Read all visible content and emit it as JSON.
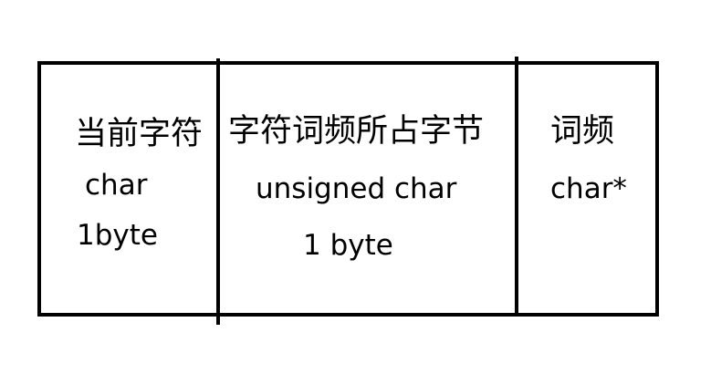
{
  "cells": [
    {
      "title": "当前字符",
      "line1": "char",
      "line2": "1byte"
    },
    {
      "title": "字符词频所占字节",
      "line1": "unsigned char",
      "line2": "1 byte"
    },
    {
      "title": "词频",
      "line1": "char*"
    }
  ],
  "colors": {
    "stroke": "#000000",
    "background": "#ffffff",
    "text": "#000000"
  }
}
